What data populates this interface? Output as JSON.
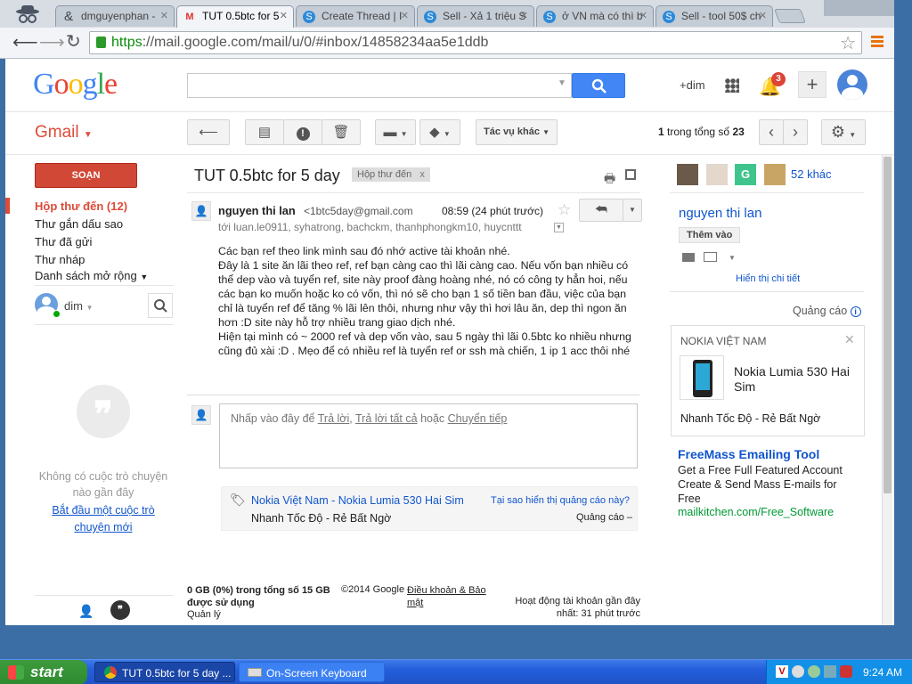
{
  "browser": {
    "tabs": [
      {
        "label": "dmguyenphan - ",
        "icon": "person-icon",
        "active": false
      },
      {
        "label": "TUT 0.5btc for 5",
        "icon": "gmail-icon",
        "active": true
      },
      {
        "label": "Create Thread | I",
        "icon": "s-logo-icon",
        "active": false
      },
      {
        "label": "Sell - Xả 1 triệu S",
        "icon": "s-logo-icon",
        "active": false
      },
      {
        "label": "ở VN mà có thì b",
        "icon": "s-logo-icon",
        "active": false
      },
      {
        "label": "Sell - tool 50$ ch",
        "icon": "s-logo-icon",
        "active": false
      }
    ],
    "url_scheme": "https",
    "url_rest": "://mail.google.com/mail/u/0/#inbox/14858234aa5e1ddb"
  },
  "header": {
    "logo": "Google",
    "search_placeholder": "",
    "user_plus": "+dim",
    "notif_count": "3"
  },
  "gmail": {
    "brand": "Gmail",
    "compose": "SOẠN",
    "nav": [
      {
        "label": "Hộp thư đến (12)",
        "active": true
      },
      {
        "label": "Thư gắn dấu sao",
        "active": false
      },
      {
        "label": "Thư đã gửi",
        "active": false
      },
      {
        "label": "Thư nháp",
        "active": false
      },
      {
        "label": "Danh sách mở rộng",
        "active": false
      }
    ],
    "hangout_user": "dim",
    "no_chats": "Không có cuộc trò chuyện nào gần đây",
    "start_chat": "Bắt đầu một cuộc trò chuyện mới",
    "more_actions": "Tác vụ khác",
    "pagination_bold": "1",
    "pagination_text": "trong tổng số",
    "pagination_total": "23"
  },
  "email": {
    "subject": "TUT 0.5btc for 5 day",
    "label_chip": "Hộp thư đến",
    "sender_name": "nguyen thi lan",
    "sender_email": "<1btc5day@gmail.com",
    "time": "08:59 (24 phút trước)",
    "to_line": "tới luan.le0911, syhatrong, bachckm, thanhphongkm10, huycnttt",
    "body": [
      "Các bạn ref theo link mình sau đó nhớ active tài khoản nhé.",
      "Đây là 1 site ăn lãi theo ref, ref bạn càng cao thì lãi càng cao. Nếu vốn bạn nhiều có thể dep vào và tuyển ref, site này proof đàng hoàng nhé, nó có công ty hẳn hoi, nếu các bạn ko muốn hoặc ko có vốn, thì nó sẽ cho bạn 1 số tiền ban đầu, việc của bạn chỉ là tuyển ref để tăng % lãi lên thôi, nhưng như vậy thì hơi lâu ăn, dep thì ngon ăn hơn :D site này hỗ trợ nhiều trang giao dịch nhé.",
      "Hiện tại mình có ~ 2000 ref và dep vốn vào, sau 5 ngày thì lãi 0.5btc ko nhiều nhưng cũng đủ xài :D . Mẹo để có nhiều ref là tuyển ref or ssh mà chiến, 1 ip 1 acc thôi nhé"
    ],
    "reply_prefix": "Nhấp vào đây để",
    "reply": "Trả lời",
    "reply_all": "Trả lời tất cả",
    "reply_or": "hoặc",
    "forward": "Chuyển tiếp",
    "ad_title": "Nokia Việt Nam - Nokia Lumia 530 Hai Sim",
    "ad_sub": "Nhanh Tốc Độ - Rẻ Bất Ngờ",
    "ad_why": "Tại sao hiển thị quảng cáo này?",
    "ad_label": "Quảng cáo –"
  },
  "footer": {
    "storage": "0 GB (0%) trong tổng số 15 GB được sử dụng",
    "manage": "Quản lý",
    "copyright": "©2014 Google -",
    "terms": "Điều khoản & Bảo mật",
    "activity": "Hoạt động tài khoản gần đây nhất: 31 phút trước"
  },
  "right": {
    "more_people": "52 khác",
    "contact_name": "nguyen thi lan",
    "add_btn": "Thêm vào",
    "show_details": "Hiển thị chi tiết",
    "ads_label": "Quảng cáo",
    "ad1_brand": "NOKIA VIỆT NAM",
    "ad1_title": "Nokia Lumia 530 Hai Sim",
    "ad1_sub": "Nhanh Tốc Độ - Rẻ Bất Ngờ",
    "ad2_title": "FreeMass Emailing Tool",
    "ad2_text": "Get a Free Full Featured Account Create & Send Mass E-mails for Free",
    "ad2_url": "mailkitchen.com/Free_Software"
  },
  "taskbar": {
    "start": "start",
    "tasks": [
      "TUT 0.5btc for 5 day ...",
      "On-Screen Keyboard"
    ],
    "clock": "9:24 AM"
  },
  "colors": {
    "gmail_red": "#dd4b39",
    "link_blue": "#1155cc",
    "google_blue": "#4285f4",
    "ad_green": "#009933",
    "xp_blue": "#245edb"
  }
}
